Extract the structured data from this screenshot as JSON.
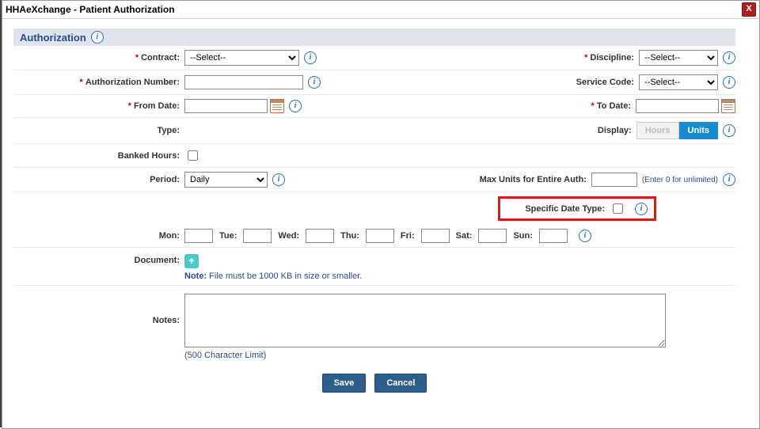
{
  "window": {
    "title": "HHAeXchange - Patient Authorization"
  },
  "section": {
    "title": "Authorization"
  },
  "labels": {
    "contract": "Contract:",
    "discipline": "Discipline:",
    "auth_number": "Authorization Number:",
    "service_code": "Service Code:",
    "from_date": "From Date:",
    "to_date": "To Date:",
    "type": "Type:",
    "display": "Display:",
    "banked_hours": "Banked Hours:",
    "period": "Period:",
    "max_units": "Max Units for Entire Auth:",
    "specific_date_type": "Specific Date Type:",
    "document": "Document:",
    "notes": "Notes:",
    "mon": "Mon:",
    "tue": "Tue:",
    "wed": "Wed:",
    "thu": "Thu:",
    "fri": "Fri:",
    "sat": "Sat:",
    "sun": "Sun:"
  },
  "values": {
    "contract": "--Select--",
    "discipline": "--Select--",
    "service_code": "--Select--",
    "period": "Daily",
    "display_hours": "Hours",
    "display_units": "Units",
    "max_units_hint": "(Enter 0 for unlimited)",
    "file_note_prefix": "Note:",
    "file_note": " File must be 1000 KB in size or smaller.",
    "char_limit": "(500 Character Limit)"
  },
  "buttons": {
    "save": "Save",
    "cancel": "Cancel"
  }
}
